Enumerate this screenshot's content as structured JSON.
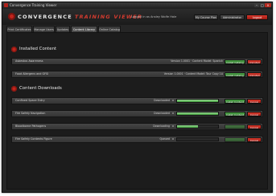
{
  "window": {
    "title": "Convergence Training Viewer",
    "controls": [
      "–",
      "□",
      "×"
    ]
  },
  "header": {
    "brand": "CONVERGENCE",
    "brand_accent": "TRAINING VIEWER",
    "logged_in": "Logged in as Ansley Wolfe Hale",
    "buttons": {
      "my_course_plan": "My Course Plan",
      "administrator": "Administrator",
      "logout": "Logout"
    }
  },
  "tabs": [
    "Print Certificates",
    "Manage Users",
    "Updates",
    "Content Library",
    "Online Catalog"
  ],
  "active_tab": "Content Library",
  "installed": {
    "title": "Installed Content",
    "items": [
      {
        "name": "Asbestos Awareness",
        "version": "Version 1.0001 · Content Model: Spanish",
        "install": "Install Catalog",
        "remove": "Uninstall"
      },
      {
        "name": "Food Allergens and GFSI",
        "version": "Version 1.0001 · Content Model: Tour Copy 1A",
        "install": "Install Catalog",
        "remove": "Uninstall"
      }
    ]
  },
  "downloads": {
    "title": "Content Downloads",
    "items": [
      {
        "name": "Confined Space Entry",
        "status": "Downloaded",
        "progress": 1.0,
        "action": "Install Content",
        "cancel": "Cancel"
      },
      {
        "name": "Fire Safety Navigation",
        "status": "Downloaded",
        "progress": 1.0,
        "action": "Install Content",
        "cancel": "Cancel"
      },
      {
        "name": "Bloodborne Pathogens",
        "status": "Downloading",
        "progress": 0.5,
        "action": "",
        "cancel": "Cancel"
      },
      {
        "name": "Fire Safety Contents Figure",
        "status": "Queued",
        "progress": 0.0,
        "action": "",
        "cancel": "Cancel"
      }
    ],
    "pause_symbol": "II"
  },
  "colors": {
    "accent_red": "#c1251d",
    "progress_green": "#5fbf58",
    "button_green": "#3a8a36"
  }
}
